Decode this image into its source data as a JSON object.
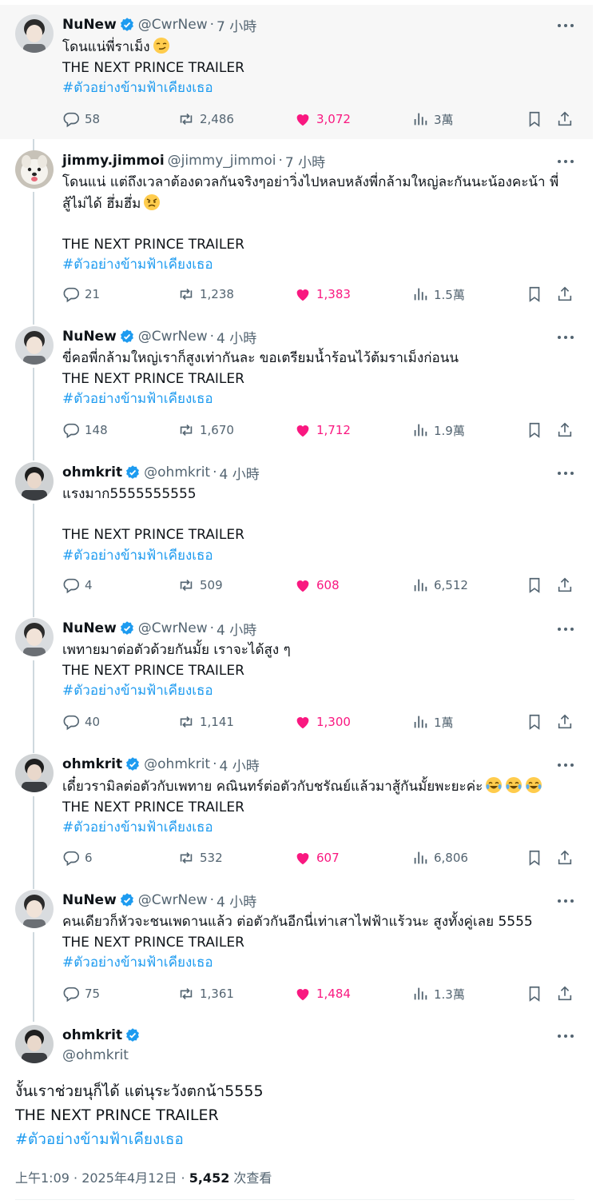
{
  "colors": {
    "accent": "#1d9bf0",
    "like": "#f91880",
    "muted": "#536471",
    "text": "#0f1419",
    "highlight_bg": "#f7f7f7"
  },
  "tweets": [
    {
      "name": "NuNew",
      "handle": "@CwrNew",
      "time": "7 小時",
      "verified": true,
      "lines": [
        "โดนแน่พี่ราเม็ง",
        "THE NEXT PRINCE TRAILER"
      ],
      "hashtag": "#ตัวอย่างข้ามฟ้าเคียงเธอ",
      "replies": "58",
      "retweets": "2,486",
      "likes": "3,072",
      "views": "3萬"
    },
    {
      "name": "jimmy.jimmoi",
      "handle": "@jimmy_jimmoi",
      "time": "7 小時",
      "verified": false,
      "lines": [
        "โดนแน่ แต่ถึงเวลาต้องดวลกันจริงๆอย่าวิ่งไปหลบหลังพี่กล้ามใหญ่ละกันนะน้องคะน้า พี่",
        "สู้ไม่ได้ ฮึ่มฮึ่ม",
        "",
        "THE NEXT PRINCE TRAILER"
      ],
      "hashtag": "#ตัวอย่างข้ามฟ้าเคียงเธอ",
      "replies": "21",
      "retweets": "1,238",
      "likes": "1,383",
      "views": "1.5萬"
    },
    {
      "name": "NuNew",
      "handle": "@CwrNew",
      "time": "4 小時",
      "verified": true,
      "lines": [
        "ขี่คอพี่กล้ามใหญ่เราก็สูงเท่ากันละ ขอเตรียมน้ำร้อนไว้ต้มราเม็งก่อนน",
        "THE NEXT PRINCE TRAILER"
      ],
      "hashtag": "#ตัวอย่างข้ามฟ้าเคียงเธอ",
      "replies": "148",
      "retweets": "1,670",
      "likes": "1,712",
      "views": "1.9萬"
    },
    {
      "name": "ohmkrit",
      "handle": "@ohmkrit",
      "time": "4 小時",
      "verified": true,
      "lines": [
        "แรงมาก5555555555",
        "",
        "THE NEXT PRINCE TRAILER"
      ],
      "hashtag": "#ตัวอย่างข้ามฟ้าเคียงเธอ",
      "replies": "4",
      "retweets": "509",
      "likes": "608",
      "views": "6,512"
    },
    {
      "name": "NuNew",
      "handle": "@CwrNew",
      "time": "4 小時",
      "verified": true,
      "lines": [
        "เพทายมาต่อตัวด้วยกันมั้ย เราจะได้สูง ๆ",
        "THE NEXT PRINCE TRAILER"
      ],
      "hashtag": "#ตัวอย่างข้ามฟ้าเคียงเธอ",
      "replies": "40",
      "retweets": "1,141",
      "likes": "1,300",
      "views": "1萬"
    },
    {
      "name": "ohmkrit",
      "handle": "@ohmkrit",
      "time": "4 小時",
      "verified": true,
      "lines": [
        "เดี๋ยวรามิลต่อตัวกับเพทาย คณินทร์ต่อตัวกับชรัณย์แล้วมาสู้กันมั้ยพะยะค่ะ",
        "THE NEXT PRINCE TRAILER"
      ],
      "hashtag": "#ตัวอย่างข้ามฟ้าเคียงเธอ",
      "replies": "6",
      "retweets": "532",
      "likes": "607",
      "views": "6,806"
    },
    {
      "name": "NuNew",
      "handle": "@CwrNew",
      "time": "4 小時",
      "verified": true,
      "lines": [
        "คนเดียวก็หัวจะชนเพดานแล้ว ต่อตัวกันอีกนี่เท่าเสาไฟฟ้าแร้วนะ สูงทั้งคู่เลย 5555",
        "THE NEXT PRINCE TRAILER"
      ],
      "hashtag": "#ตัวอย่างข้ามฟ้าเคียงเธอ",
      "replies": "75",
      "retweets": "1,361",
      "likes": "1,484",
      "views": "1.3萬"
    }
  ],
  "main_tweet": {
    "name": "ohmkrit",
    "handle": "@ohmkrit",
    "lines": [
      "งั้นเราช่วยนุก็ได้ แต่นุระวังตกน้า5555",
      "THE NEXT PRINCE TRAILER"
    ],
    "hashtag": "#ตัวอย่างข้ามฟ้าเคียงเธอ",
    "timestamp": "上午1:09 · 2025年4月12日 · ",
    "views_count": "5,452",
    "views_label": " 次查看"
  },
  "icons": [
    "reply-icon",
    "retweet-icon",
    "heart-icon",
    "views-icon",
    "bookmark-icon",
    "share-icon",
    "more-icon",
    "verified-badge-icon"
  ]
}
